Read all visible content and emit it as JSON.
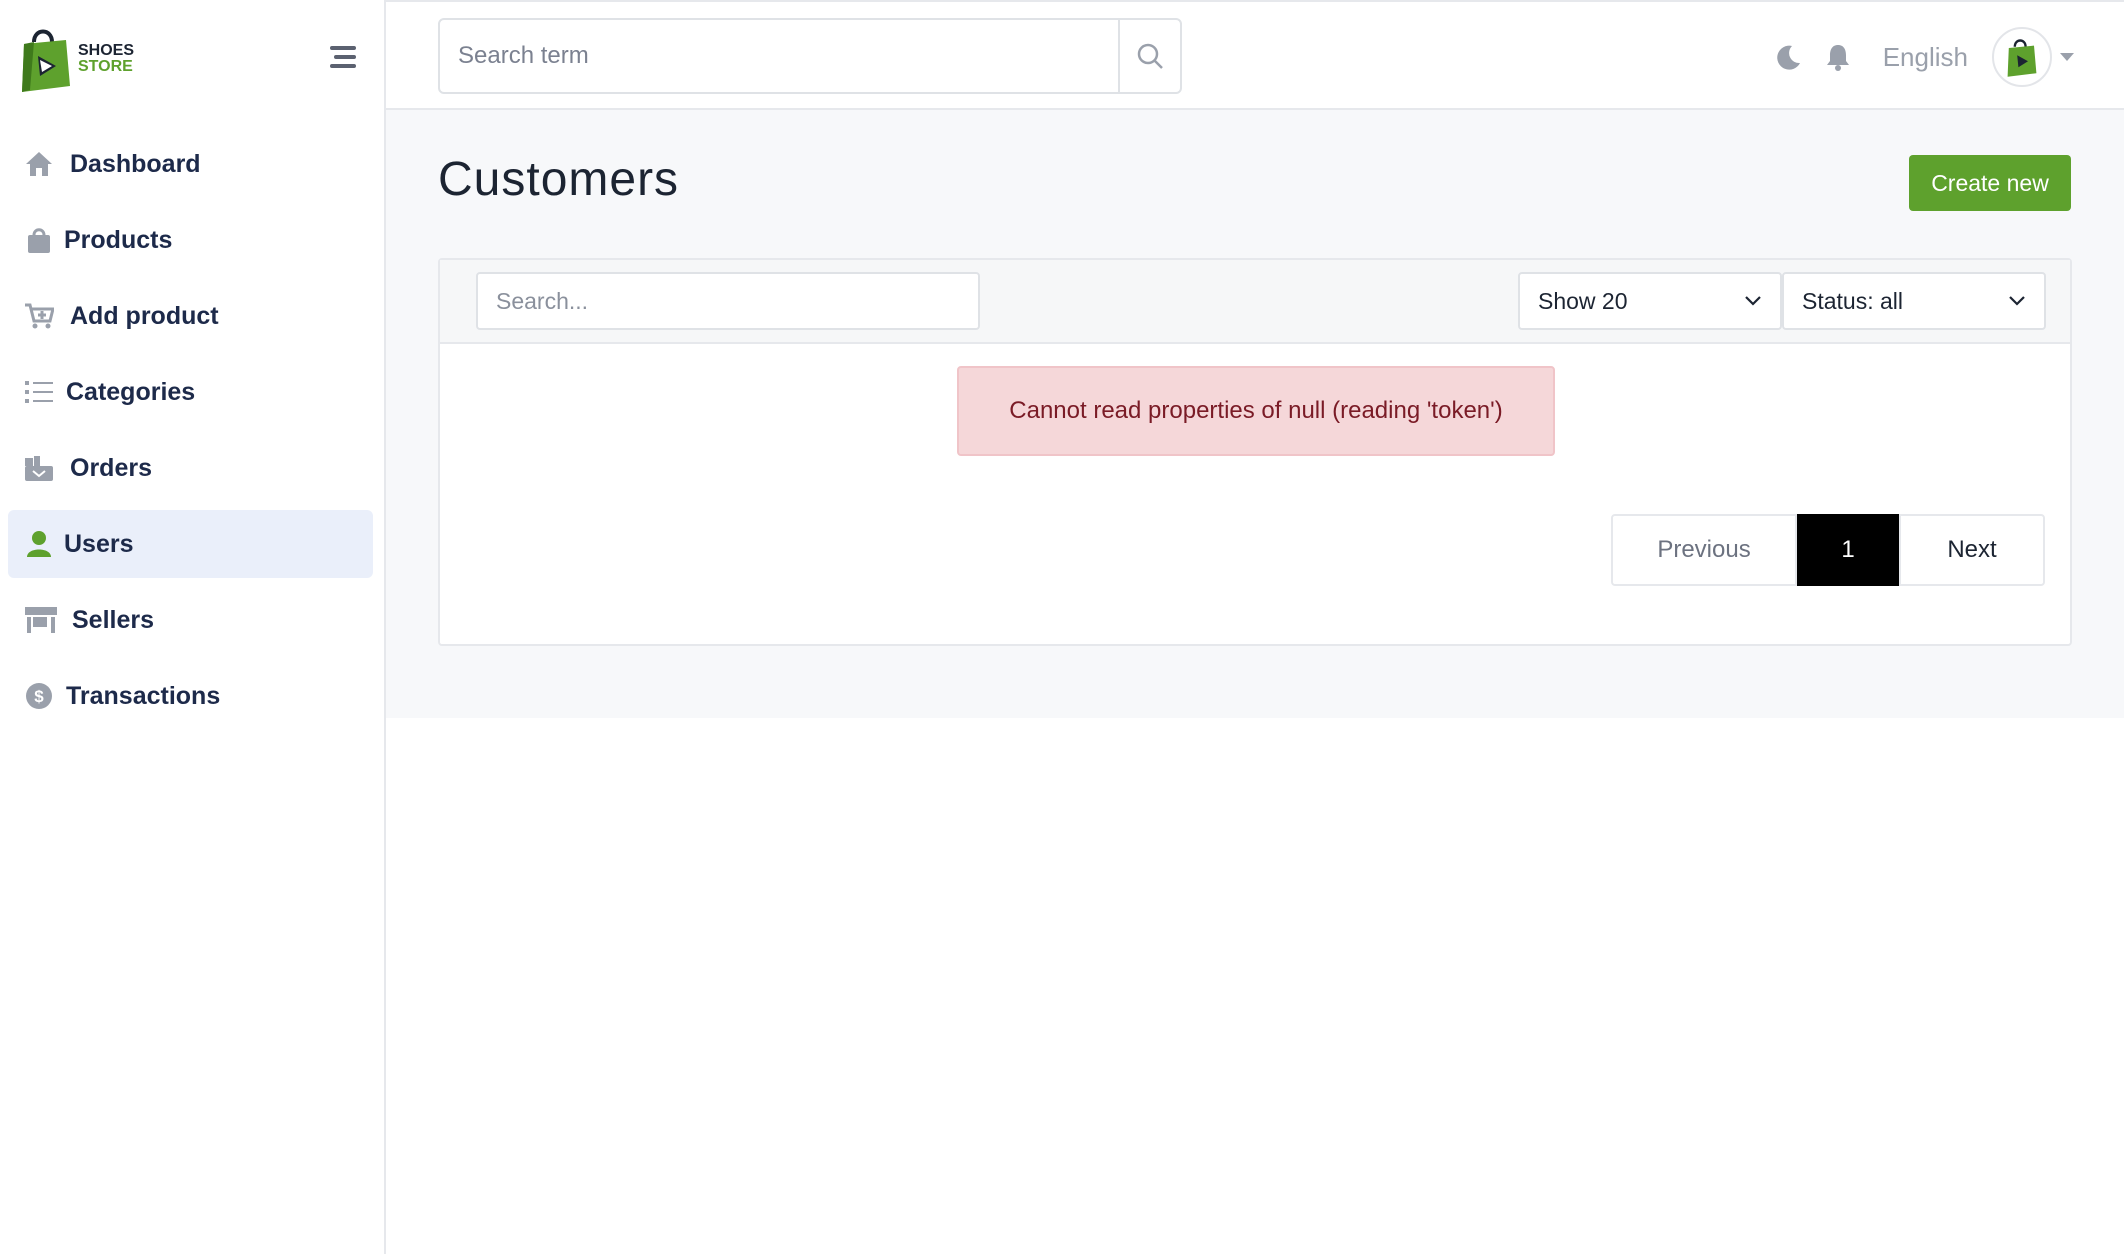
{
  "brand": {
    "line1": "SHOES",
    "line2": "STORE"
  },
  "sidebar": {
    "items": [
      {
        "label": "Dashboard",
        "icon": "home-icon"
      },
      {
        "label": "Products",
        "icon": "shopping-bag-icon"
      },
      {
        "label": "Add product",
        "icon": "cart-plus-icon"
      },
      {
        "label": "Categories",
        "icon": "list-icon"
      },
      {
        "label": "Orders",
        "icon": "orders-icon"
      },
      {
        "label": "Users",
        "icon": "user-icon",
        "active": true
      },
      {
        "label": "Sellers",
        "icon": "store-icon"
      },
      {
        "label": "Transactions",
        "icon": "dollar-icon"
      }
    ]
  },
  "header": {
    "search_placeholder": "Search term",
    "language": "English"
  },
  "main": {
    "title": "Customers",
    "create_label": "Create new",
    "filter_search_placeholder": "Search...",
    "show_select": "Show 20",
    "status_select": "Status: all",
    "error_message": "Cannot read properties of null (reading 'token')",
    "pagination": {
      "previous": "Previous",
      "current": "1",
      "next": "Next"
    }
  },
  "colors": {
    "accent": "#5ea12d",
    "active_bg": "#eaeffa",
    "error_bg": "#f5d7d9",
    "error_text": "#7a1b26"
  }
}
